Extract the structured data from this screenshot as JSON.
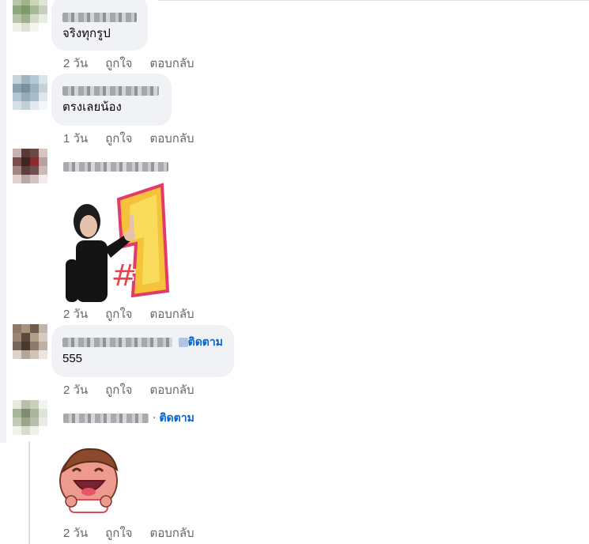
{
  "comments": [
    {
      "id": "c1",
      "text": "จริงทุกรูป",
      "meta": {
        "time": "2 วัน",
        "like": "ถูกใจ",
        "reply": "ตอบกลับ"
      }
    },
    {
      "id": "c2",
      "text": "ตรงเลยน้อง",
      "meta": {
        "time": "1 วัน",
        "like": "ถูกใจ",
        "reply": "ตอบกลับ"
      }
    },
    {
      "id": "c3",
      "sticker": "number-one-sticker",
      "meta": {
        "time": "2 วัน",
        "like": "ถูกใจ",
        "reply": "ตอบกลับ"
      }
    },
    {
      "id": "c4",
      "follow": "ติดตาม",
      "text": "555",
      "meta": {
        "time": "2 วัน",
        "like": "ถูกใจ",
        "reply": "ตอบกลับ"
      }
    },
    {
      "id": "c5",
      "follow": "ติดตาม",
      "sticker": "laughing-character-sticker",
      "meta": {
        "time": "2 วัน",
        "like": "ถูกใจ",
        "reply": "ตอบกลับ"
      }
    }
  ],
  "colors": {
    "bubble": "#f0f2f5",
    "meta_text": "#65676b",
    "follow_link": "#0064d1"
  }
}
